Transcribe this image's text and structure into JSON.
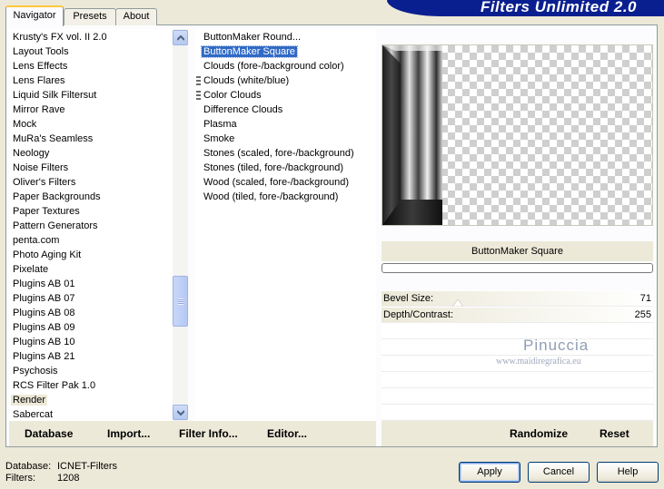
{
  "banner": {
    "title": "Filters Unlimited 2.0"
  },
  "tabs": [
    {
      "label": "Navigator",
      "active": true
    },
    {
      "label": "Presets",
      "active": false
    },
    {
      "label": "About",
      "active": false
    }
  ],
  "categories": {
    "items": [
      "Krusty's FX vol. II 2.0",
      "Layout Tools",
      "Lens Effects",
      "Lens Flares",
      "Liquid Silk Filtersut",
      "Mirror Rave",
      "Mock",
      "MuRa's Seamless",
      "Neology",
      "Noise Filters",
      "Oliver's Filters",
      "Paper Backgrounds",
      "Paper Textures",
      "Pattern Generators",
      "penta.com",
      "Photo Aging Kit",
      "Pixelate",
      "Plugins AB 01",
      "Plugins AB 07",
      "Plugins AB 08",
      "Plugins AB 09",
      "Plugins AB 10",
      "Plugins AB 21",
      "Psychosis",
      "RCS Filter Pak 1.0",
      "Render",
      "Sabercat"
    ],
    "current": "Render"
  },
  "filters": {
    "items": [
      {
        "label": "ButtonMaker Round...",
        "selected": false,
        "grip": false
      },
      {
        "label": "ButtonMaker Square",
        "selected": true,
        "grip": false
      },
      {
        "label": "Clouds (fore-/background color)",
        "selected": false,
        "grip": false
      },
      {
        "label": "Clouds (white/blue)",
        "selected": false,
        "grip": true
      },
      {
        "label": "Color Clouds",
        "selected": false,
        "grip": true
      },
      {
        "label": "Difference Clouds",
        "selected": false,
        "grip": false
      },
      {
        "label": "Plasma",
        "selected": false,
        "grip": false
      },
      {
        "label": "Smoke",
        "selected": false,
        "grip": false
      },
      {
        "label": "Stones (scaled, fore-/background)",
        "selected": false,
        "grip": false
      },
      {
        "label": "Stones (tiled, fore-/background)",
        "selected": false,
        "grip": false
      },
      {
        "label": "Wood (scaled, fore-/background)",
        "selected": false,
        "grip": false
      },
      {
        "label": "Wood (tiled, fore-/background)",
        "selected": false,
        "grip": false
      }
    ]
  },
  "preview": {
    "effect_name": "ButtonMaker Square"
  },
  "params": [
    {
      "label": "Bevel Size:",
      "value": "71"
    },
    {
      "label": "Depth/Contrast:",
      "value": "255"
    }
  ],
  "watermark": {
    "name": "Pinuccia",
    "url": "www.maidiregrafica.eu"
  },
  "linkbar": {
    "database": "Database",
    "import": "Import...",
    "filter_info": "Filter Info...",
    "editor": "Editor...",
    "randomize": "Randomize",
    "reset": "Reset"
  },
  "footer": {
    "database_label": "Database:",
    "database_value": "ICNET-Filters",
    "filters_label": "Filters:",
    "filters_value": "1208"
  },
  "buttons": {
    "apply": "Apply",
    "cancel": "Cancel",
    "help": "Help"
  }
}
